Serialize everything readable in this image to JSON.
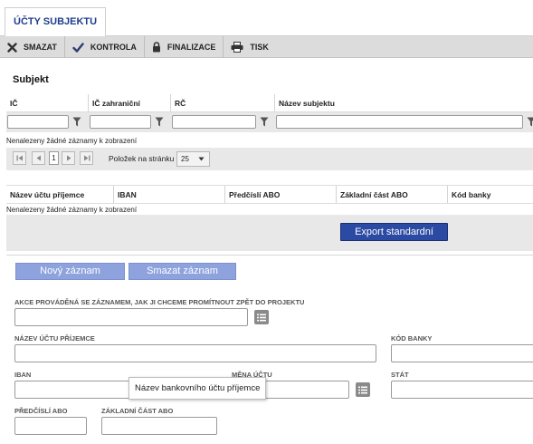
{
  "tab": {
    "label": "ÚČTY SUBJEKTU"
  },
  "toolbar": {
    "delete_label": "SMAZAT",
    "check_label": "KONTROLA",
    "finalize_label": "FINALIZACE",
    "print_label": "TISK"
  },
  "subject": {
    "title": "Subjekt",
    "columns": [
      "IČ",
      "IČ zahraniční",
      "RČ",
      "Název subjektu"
    ],
    "no_records": "Nenalezeny žádné záznamy k zobrazení",
    "pager": {
      "page": "1",
      "per_page_label": "Položek na stránku",
      "per_page_value": "25"
    }
  },
  "accounts": {
    "columns": [
      "Název účtu příjemce",
      "IBAN",
      "Předčíslí ABO",
      "Základní část ABO",
      "Kód banky"
    ],
    "no_records": "Nenalezeny žádné záznamy k zobrazení",
    "export_label": "Export standardní"
  },
  "actions": {
    "new_label": "Nový záznam",
    "delete_label": "Smazat záznam"
  },
  "form": {
    "action_label": "AKCE PROVÁDĚNÁ SE ZÁZNAMEM, JAK JI CHCEME PROMÍTNOUT ZPĚT DO PROJEKTU",
    "account_name_label": "NÁZEV ÚČTU PŘÍJEMCE",
    "bank_code_label": "KÓD BANKY",
    "iban_label": "IBAN",
    "currency_label": "MĚNA ÚČTU",
    "state_label": "STÁT",
    "prefix_label": "PŘEDČÍSLÍ ABO",
    "base_label": "ZÁKLADNÍ ČÁST ABO"
  },
  "tooltip": {
    "text": "Název bankovního účtu příjemce"
  },
  "colors": {
    "accent": "#2b4aa3",
    "accent_light": "#8ea3dd",
    "tab_text": "#1d3c8c",
    "panel": "#e8e8e8"
  }
}
